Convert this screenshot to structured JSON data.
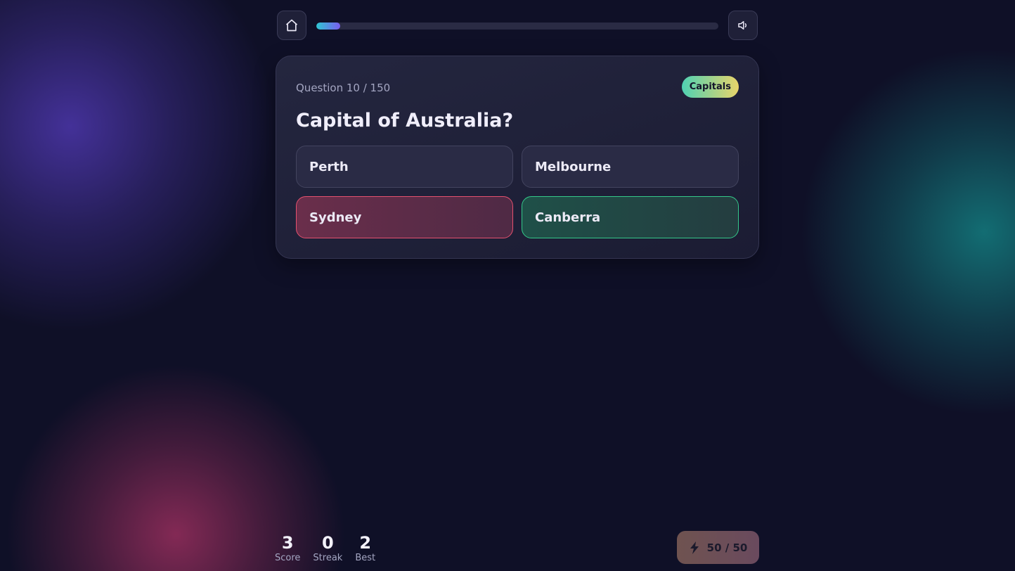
{
  "progress": {
    "current": 10,
    "total": 150,
    "fraction": 0.06
  },
  "header": {
    "home_icon": "home-icon",
    "sound_icon": "speaker-icon"
  },
  "question_card": {
    "counter": "Question 10 / 150",
    "category": "Capitals",
    "question": "Capital of Australia?",
    "answers": [
      {
        "label": "Perth",
        "state": "neutral"
      },
      {
        "label": "Melbourne",
        "state": "neutral"
      },
      {
        "label": "Sydney",
        "state": "wrong"
      },
      {
        "label": "Canberra",
        "state": "correct"
      }
    ]
  },
  "stats": {
    "score": {
      "value": "3",
      "label": "Score"
    },
    "streak": {
      "value": "0",
      "label": "Streak"
    },
    "best": {
      "value": "2",
      "label": "Best"
    }
  },
  "energy": {
    "icon": "lightning-icon",
    "text": "50 / 50"
  },
  "colors": {
    "wrong": "#e4516f",
    "correct": "#34c98a",
    "progress_start": "#2ec7d3",
    "progress_end": "#7b5cf0"
  }
}
